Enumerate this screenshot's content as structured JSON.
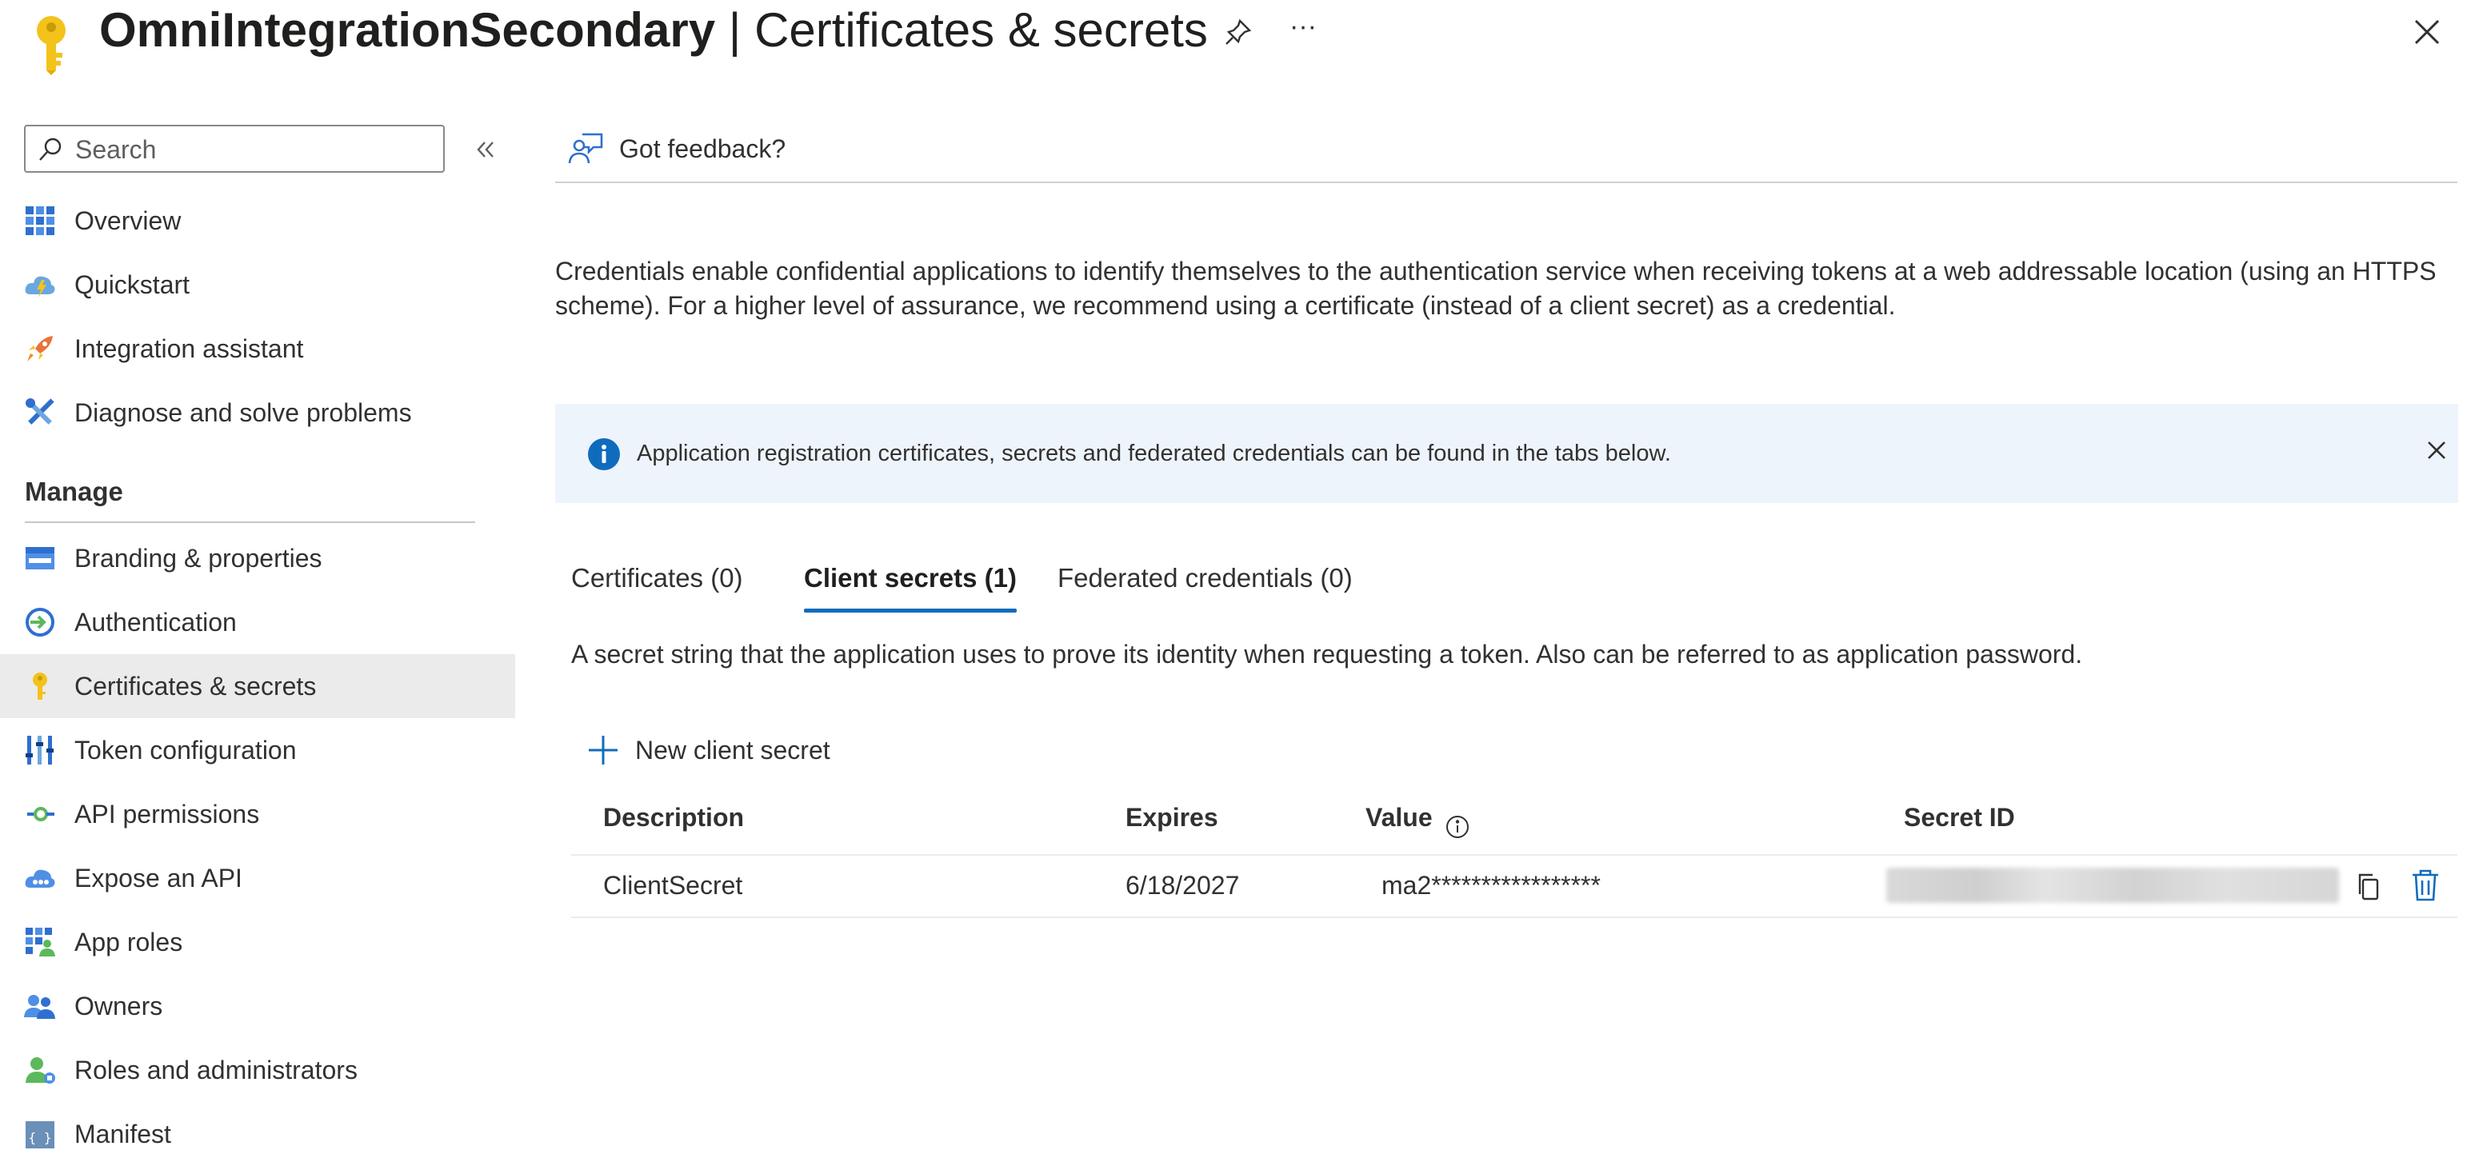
{
  "header": {
    "app_name": "OmniIntegrationSecondary",
    "separator": " | ",
    "page_name": "Certificates & secrets",
    "more_label": "···"
  },
  "sidebar": {
    "search_placeholder": "Search",
    "items_top": [
      {
        "label": "Overview",
        "icon": "overview-grid-icon"
      },
      {
        "label": "Quickstart",
        "icon": "cloud-lightning-icon"
      },
      {
        "label": "Integration assistant",
        "icon": "rocket-icon"
      },
      {
        "label": "Diagnose and solve problems",
        "icon": "tools-icon"
      }
    ],
    "section_label": "Manage",
    "items_manage": [
      {
        "label": "Branding & properties",
        "icon": "branding-icon"
      },
      {
        "label": "Authentication",
        "icon": "authentication-icon"
      },
      {
        "label": "Certificates & secrets",
        "icon": "key-icon",
        "active": true
      },
      {
        "label": "Token configuration",
        "icon": "token-bars-icon"
      },
      {
        "label": "API permissions",
        "icon": "api-permissions-icon"
      },
      {
        "label": "Expose an API",
        "icon": "cloud-api-icon"
      },
      {
        "label": "App roles",
        "icon": "app-roles-icon"
      },
      {
        "label": "Owners",
        "icon": "owners-icon"
      },
      {
        "label": "Roles and administrators",
        "icon": "roles-admin-icon"
      },
      {
        "label": "Manifest",
        "icon": "manifest-icon"
      }
    ]
  },
  "main": {
    "feedback_label": "Got feedback?",
    "intro": "Credentials enable confidential applications to identify themselves to the authentication service when receiving tokens at a web addressable location (using an HTTPS scheme). For a higher level of assurance, we recommend using a certificate (instead of a client secret) as a credential.",
    "banner": "Application registration certificates, secrets and federated credentials can be found in the tabs below.",
    "tabs": [
      {
        "label": "Certificates (0)"
      },
      {
        "label": "Client secrets (1)",
        "selected": true
      },
      {
        "label": "Federated credentials (0)"
      }
    ],
    "tab_description": "A secret string that the application uses to prove its identity when requesting a token. Also can be referred to as application password.",
    "new_secret_label": "New client secret",
    "table": {
      "headers": [
        "Description",
        "Expires",
        "Value",
        "Secret ID"
      ],
      "rows": [
        {
          "description": "ClientSecret",
          "expires": "6/18/2027",
          "value": "ma2*****************",
          "secret_id": ""
        }
      ]
    }
  },
  "colors": {
    "accent": "#0f6cbd",
    "key_yellow": "#f3c31b",
    "banner_bg": "#eef4fb",
    "active_nav_bg": "#ebebeb"
  }
}
